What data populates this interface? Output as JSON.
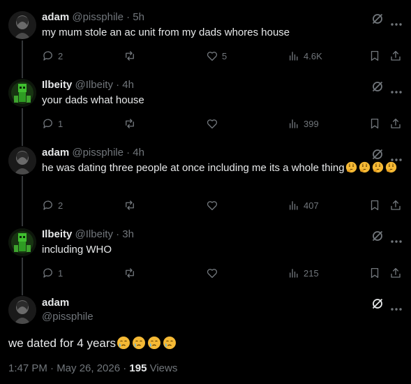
{
  "tweets": [
    {
      "name": "adam",
      "handle": "@pissphile",
      "separator": "·",
      "time": "5h",
      "text": "my mum stole an ac unit from my dads whores house",
      "replies": "2",
      "reposts": "",
      "likes": "5",
      "views": "4.6K"
    },
    {
      "name": "Ilbeity",
      "handle": "@Ilbeity",
      "separator": "·",
      "time": "4h",
      "text": "your dads what house",
      "replies": "1",
      "reposts": "",
      "likes": "",
      "views": "399"
    },
    {
      "name": "adam",
      "handle": "@pissphile",
      "separator": "·",
      "time": "4h",
      "text": "he was dating three people at once including me its a whole thing",
      "emojis": [
        "thinking-face",
        "thinking-face",
        "thinking-face",
        "thinking-face"
      ],
      "replies": "2",
      "reposts": "",
      "likes": "",
      "views": "407"
    },
    {
      "name": "Ilbeity",
      "handle": "@Ilbeity",
      "separator": "·",
      "time": "3h",
      "text": "including WHO",
      "replies": "1",
      "reposts": "",
      "likes": "",
      "views": "215"
    }
  ],
  "focused_tweet": {
    "name": "adam",
    "handle": "@pissphile",
    "text": "we dated for 4 years",
    "emojis": [
      "crying-face",
      "crying-face",
      "crying-face",
      "crying-face"
    ],
    "time": "1:47 PM · May 26, 2026 · ",
    "views_count": "195",
    "views_label": " Views"
  },
  "icons": {
    "grok": "grok-icon",
    "more": "more-icon",
    "reply": "reply-icon",
    "repost": "repost-icon",
    "like": "like-icon",
    "views": "views-icon",
    "bookmark": "bookmark-icon",
    "share": "share-icon"
  },
  "colors": {
    "background": "#000000",
    "text": "#e7e9ea",
    "secondary": "#71767b",
    "thread_line": "#333639"
  }
}
